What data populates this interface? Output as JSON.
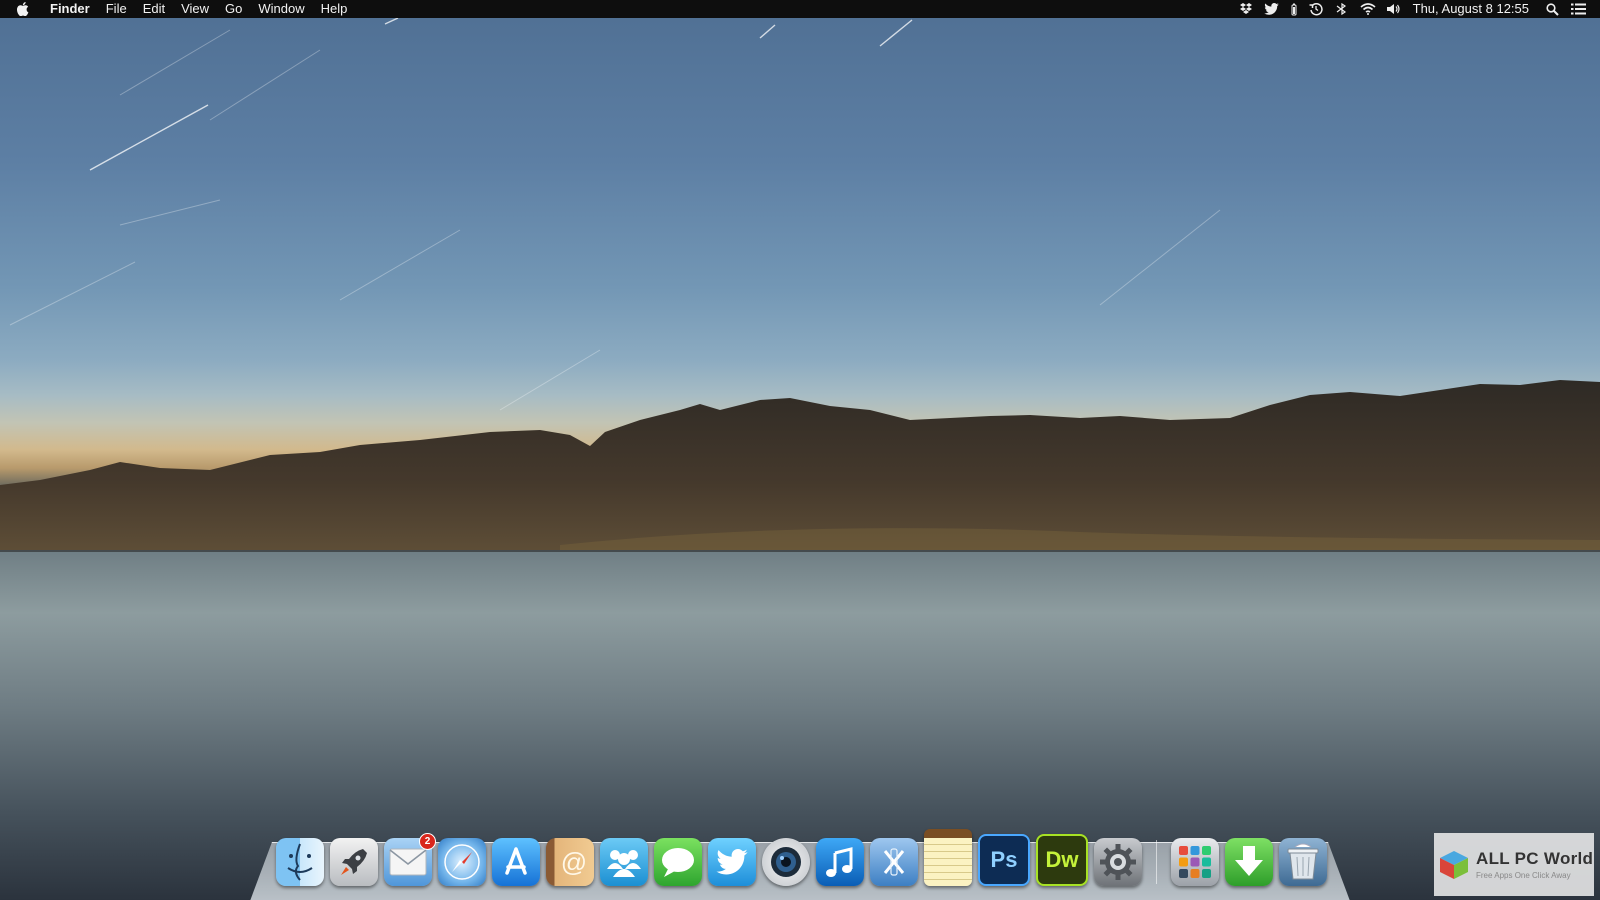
{
  "menubar": {
    "app_name": "Finder",
    "items": [
      "File",
      "Edit",
      "View",
      "Go",
      "Window",
      "Help"
    ],
    "clock": "Thu, August 8  12:55",
    "status_icons": [
      "dropbox-icon",
      "twitter-icon",
      "battery-icon",
      "time-machine-icon",
      "bluetooth-icon",
      "wifi-icon",
      "volume-icon",
      "spotlight-icon",
      "notification-center-icon"
    ]
  },
  "dock": {
    "apps": [
      {
        "name": "Finder",
        "icon": "finder-icon"
      },
      {
        "name": "Launchpad",
        "icon": "launchpad-icon"
      },
      {
        "name": "Mail",
        "icon": "mail-icon",
        "badge": "2"
      },
      {
        "name": "Safari",
        "icon": "safari-icon"
      },
      {
        "name": "App Store",
        "icon": "app-store-icon"
      },
      {
        "name": "Contacts",
        "icon": "contacts-icon"
      },
      {
        "name": "Messenger",
        "icon": "people-icon"
      },
      {
        "name": "Messages",
        "icon": "messages-icon"
      },
      {
        "name": "Twitter",
        "icon": "twitter-icon"
      },
      {
        "name": "Camera",
        "icon": "camera-icon"
      },
      {
        "name": "iTunes",
        "icon": "itunes-icon"
      },
      {
        "name": "Xcode",
        "icon": "xcode-icon"
      },
      {
        "name": "Notes",
        "icon": "notes-icon"
      },
      {
        "name": "Photoshop",
        "icon": "photoshop-icon",
        "label": "Ps"
      },
      {
        "name": "Dreamweaver",
        "icon": "dreamweaver-icon",
        "label": "Dw"
      },
      {
        "name": "System Preferences",
        "icon": "system-preferences-icon"
      }
    ],
    "folders": [
      {
        "name": "Applications",
        "icon": "applications-folder-icon"
      },
      {
        "name": "Downloads",
        "icon": "downloads-icon"
      },
      {
        "name": "Trash",
        "icon": "trash-icon"
      }
    ]
  },
  "watermark": {
    "title": "ALL PC World",
    "subtitle": "Free Apps One Click Away"
  },
  "colors": {
    "menubar_bg": "#0e0e0e",
    "photoshop": "#0d2c54",
    "dreamweaver": "#2d3a0e",
    "badge": "#d9261c"
  }
}
